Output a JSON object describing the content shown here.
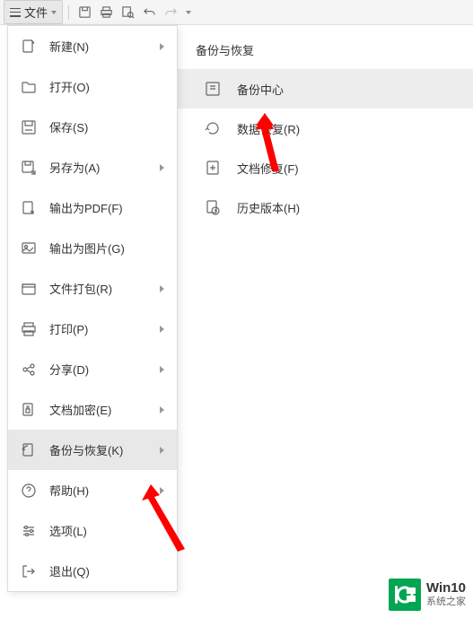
{
  "toolbar": {
    "file_label": "文件"
  },
  "menu": {
    "items": [
      {
        "label": "新建(N)",
        "has_sub": true
      },
      {
        "label": "打开(O)",
        "has_sub": false
      },
      {
        "label": "保存(S)",
        "has_sub": false
      },
      {
        "label": "另存为(A)",
        "has_sub": true
      },
      {
        "label": "输出为PDF(F)",
        "has_sub": false
      },
      {
        "label": "输出为图片(G)",
        "has_sub": false
      },
      {
        "label": "文件打包(R)",
        "has_sub": true
      },
      {
        "label": "打印(P)",
        "has_sub": true
      },
      {
        "label": "分享(D)",
        "has_sub": true
      },
      {
        "label": "文档加密(E)",
        "has_sub": true
      },
      {
        "label": "备份与恢复(K)",
        "has_sub": true
      },
      {
        "label": "帮助(H)",
        "has_sub": true
      },
      {
        "label": "选项(L)",
        "has_sub": false
      },
      {
        "label": "退出(Q)",
        "has_sub": false
      }
    ]
  },
  "submenu": {
    "header": "备份与恢复",
    "items": [
      {
        "label": "备份中心"
      },
      {
        "label": "数据恢复(R)"
      },
      {
        "label": "文档修复(F)"
      },
      {
        "label": "历史版本(H)"
      }
    ]
  },
  "watermark": {
    "top": "Win10",
    "bottom": "系统之家"
  }
}
